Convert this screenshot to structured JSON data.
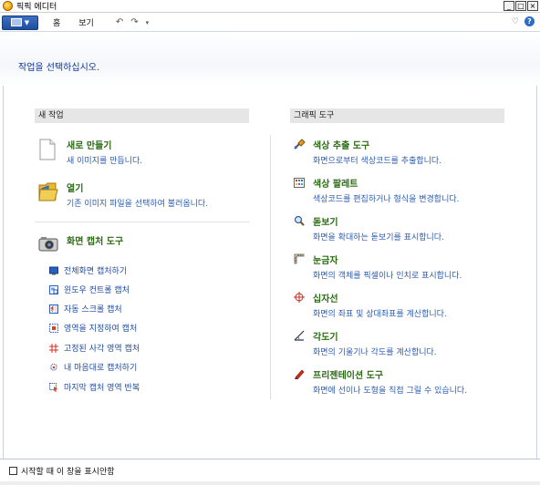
{
  "window": {
    "title": "픽픽 에디터"
  },
  "ribbon": {
    "tabs": [
      "홈",
      "보기"
    ]
  },
  "header": {
    "title": "작업을 선택하십시오."
  },
  "left_section": {
    "title": "새 작업",
    "items": [
      {
        "title": "새로 만들기",
        "desc": "새 이미지를 만듭니다."
      },
      {
        "title": "열기",
        "desc": "기존 이미지 파일을 선택하여 불러옵니다."
      },
      {
        "title": "화면 캡처 도구"
      }
    ],
    "capture_items": [
      "전체화면 캡처하기",
      "윈도우 컨트롤 캡처",
      "자동 스크롤 캡처",
      "영역을 지정하여 캡처",
      "고정된 사각 영역 캡처",
      "내 마음대로 캡처하기",
      "마지막 캡처 영역 반복"
    ]
  },
  "right_section": {
    "title": "그래픽 도구",
    "items": [
      {
        "title": "색상 추출 도구",
        "desc": "화면으로부터 색상코드를 추출합니다."
      },
      {
        "title": "색상 팔레트",
        "desc": "색상코드를 편집하거나 형식을 변경합니다."
      },
      {
        "title": "돋보기",
        "desc": "화면을 확대하는 돋보기를 표시합니다."
      },
      {
        "title": "눈금자",
        "desc": "화면의 객체를 픽셀이나 인치로 표시합니다."
      },
      {
        "title": "십자선",
        "desc": "화면의 좌표 및 상대좌표를 계산합니다."
      },
      {
        "title": "각도기",
        "desc": "화면의 기울기나 각도를 계산합니다."
      },
      {
        "title": "프리젠테이션 도구",
        "desc": "화면에 선이나 도형을 직접 그릴 수 있습니다."
      }
    ]
  },
  "footer": {
    "checkbox_label": "시작할 때 이 창을 표시안함"
  },
  "colors": {
    "title_green": "#2a6c13",
    "desc_blue": "#2a5bb0",
    "header_blue": "#113399"
  }
}
